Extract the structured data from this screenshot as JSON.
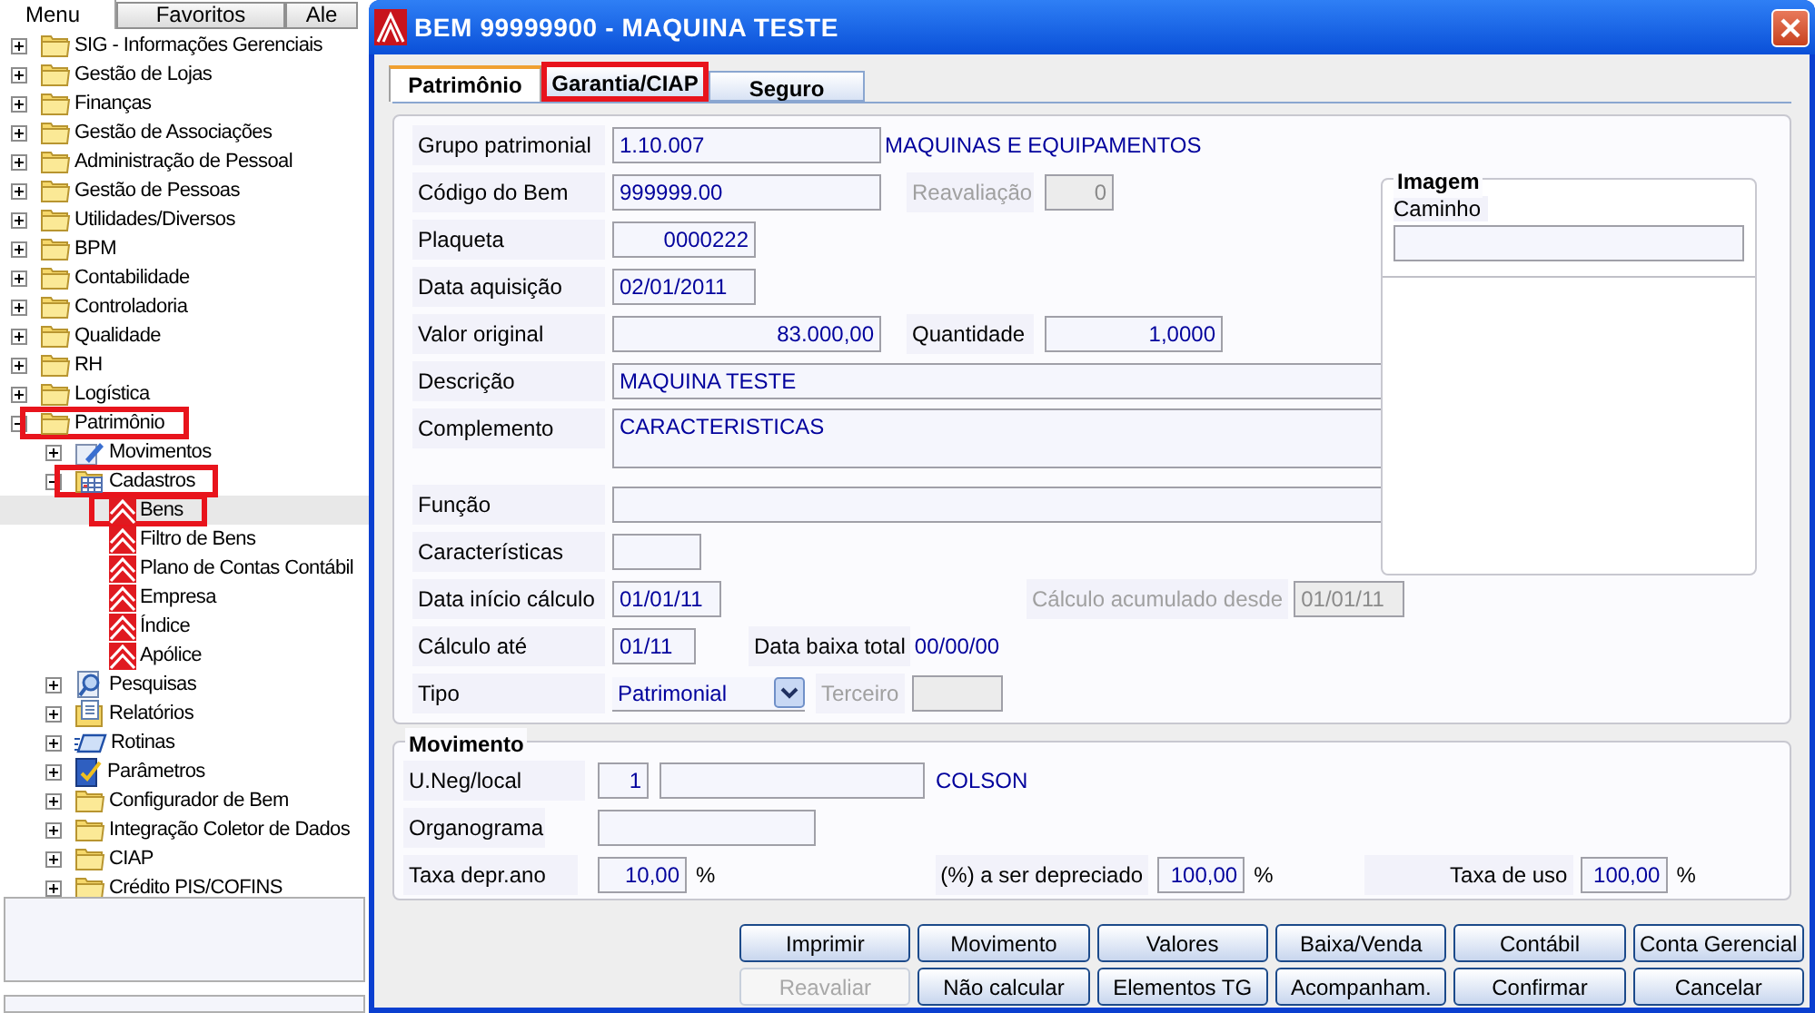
{
  "sidebar": {
    "tabs": [
      {
        "label": "Menu",
        "selected": true
      },
      {
        "label": "Favoritos",
        "selected": false
      },
      {
        "label": "Ale",
        "selected": false
      }
    ],
    "tree": [
      {
        "label": "SIG - Informações Gerenciais",
        "kind": "folder",
        "expanded": false,
        "selected": false
      },
      {
        "label": "Gestão de Lojas",
        "kind": "folder",
        "expanded": false,
        "selected": false
      },
      {
        "label": "Finanças",
        "kind": "folder",
        "expanded": false,
        "selected": false
      },
      {
        "label": "Gestão de Associações",
        "kind": "folder",
        "expanded": false,
        "selected": false
      },
      {
        "label": "Administração de Pessoal",
        "kind": "folder",
        "expanded": false,
        "selected": false
      },
      {
        "label": "Gestão de Pessoas",
        "kind": "folder",
        "expanded": false,
        "selected": false
      },
      {
        "label": "Utilidades/Diversos",
        "kind": "folder",
        "expanded": false,
        "selected": false
      },
      {
        "label": "BPM",
        "kind": "folder",
        "expanded": false,
        "selected": false
      },
      {
        "label": "Contabilidade",
        "kind": "folder",
        "expanded": false,
        "selected": false
      },
      {
        "label": "Controladoria",
        "kind": "folder",
        "expanded": false,
        "selected": false
      },
      {
        "label": "Qualidade",
        "kind": "folder",
        "expanded": false,
        "selected": false
      },
      {
        "label": "RH",
        "kind": "folder",
        "expanded": false,
        "selected": false
      },
      {
        "label": "Logística",
        "kind": "folder",
        "expanded": false,
        "selected": false
      },
      {
        "label": "Patrimônio",
        "kind": "folder",
        "expanded": true,
        "selected": false,
        "highlighted": true,
        "children": [
          {
            "label": "Movimentos",
            "kind": "pencil",
            "expanded": false,
            "selected": false
          },
          {
            "label": "Cadastros",
            "kind": "grid",
            "expanded": true,
            "selected": false,
            "highlighted": true,
            "children": [
              {
                "label": "Bens",
                "kind": "red",
                "selected": true,
                "highlighted": true
              },
              {
                "label": "Filtro de Bens",
                "kind": "red",
                "selected": false
              },
              {
                "label": "Plano de Contas Contábil",
                "kind": "red",
                "selected": false
              },
              {
                "label": "Empresa",
                "kind": "red",
                "selected": false
              },
              {
                "label": "Índice",
                "kind": "red",
                "selected": false
              },
              {
                "label": "Apólice",
                "kind": "red",
                "selected": false
              }
            ]
          },
          {
            "label": "Pesquisas",
            "kind": "magnifier",
            "expanded": false,
            "selected": false
          },
          {
            "label": "Relatórios",
            "kind": "document",
            "expanded": false,
            "selected": false
          },
          {
            "label": "Rotinas",
            "kind": "routine",
            "expanded": false,
            "selected": false
          },
          {
            "label": "Parâmetros",
            "kind": "parameter",
            "expanded": false,
            "selected": false
          },
          {
            "label": "Configurador de Bem",
            "kind": "folder",
            "expanded": false,
            "selected": false
          },
          {
            "label": "Integração Coletor de Dados",
            "kind": "folder",
            "expanded": false,
            "selected": false
          },
          {
            "label": "CIAP",
            "kind": "folder",
            "expanded": false,
            "selected": false
          },
          {
            "label": "Crédito PIS/COFINS",
            "kind": "folder",
            "expanded": false,
            "selected": false
          }
        ]
      }
    ]
  },
  "dialog": {
    "title": "BEM 99999900 - MAQUINA TESTE",
    "tabs": [
      {
        "label": "Patrimônio",
        "selected": true,
        "highlighted": false
      },
      {
        "label": "Garantia/CIAP",
        "selected": false,
        "highlighted": true
      },
      {
        "label": "Seguro",
        "selected": false,
        "highlighted": false
      }
    ],
    "form": {
      "grupo_patrimonial": {
        "label": "Grupo patrimonial",
        "value": "1.10.007",
        "description": "MAQUINAS E EQUIPAMENTOS"
      },
      "codigo_do_bem": {
        "label": "Código do Bem",
        "value": "999999.00"
      },
      "reavaliacao": {
        "label": "Reavaliação",
        "value": "0",
        "disabled": true
      },
      "plaqueta": {
        "label": "Plaqueta",
        "value": "0000222"
      },
      "data_aquisicao": {
        "label": "Data aquisição",
        "value": "02/01/2011"
      },
      "valor_original": {
        "label": "Valor original",
        "value": "83.000,00"
      },
      "quantidade": {
        "label": "Quantidade",
        "value": "1,0000"
      },
      "descricao": {
        "label": "Descrição",
        "value": "MAQUINA TESTE"
      },
      "complemento": {
        "label": "Complemento",
        "value": "CARACTERISTICAS"
      },
      "funcao": {
        "label": "Função"
      },
      "caracteristicas": {
        "label": "Características"
      },
      "data_inicio_calculo": {
        "label": "Data início cálculo",
        "value": "01/01/11"
      },
      "calculo_acumulado_desde": {
        "label": "Cálculo acumulado desde",
        "value": "01/01/11",
        "disabled": true
      },
      "calculo_ate": {
        "label": "Cálculo até",
        "value": "01/11"
      },
      "data_baixa_total": {
        "label": "Data baixa total",
        "value": "00/00/00"
      },
      "tipo": {
        "label": "Tipo",
        "value": "Patrimonial"
      },
      "terceiro": {
        "label": "Terceiro",
        "disabled": true
      }
    },
    "imagem": {
      "title": "Imagem",
      "caminho_label": "Caminho"
    },
    "movimento": {
      "title": "Movimento",
      "u_neg_local": {
        "label": "U.Neg/local",
        "value": "1",
        "description": "COLSON"
      },
      "organograma": {
        "label": "Organograma"
      },
      "taxa_depr_ano": {
        "label": "Taxa depr.ano",
        "value": "10,00",
        "unit": "%"
      },
      "a_ser_depreciado": {
        "label": "(%) a ser depreciado",
        "value": "100,00",
        "unit": "%"
      },
      "taxa_de_uso": {
        "label": "Taxa de uso",
        "value": "100,00",
        "unit": "%"
      }
    },
    "buttons": [
      {
        "label": "Imprimir",
        "disabled": false
      },
      {
        "label": "Movimento",
        "disabled": false
      },
      {
        "label": "Valores",
        "disabled": false
      },
      {
        "label": "Baixa/Venda",
        "disabled": false
      },
      {
        "label": "Contábil",
        "disabled": false
      },
      {
        "label": "Conta Gerencial",
        "disabled": false
      },
      {
        "label": "Reavaliar",
        "disabled": true
      },
      {
        "label": "Não calcular",
        "disabled": false
      },
      {
        "label": "Elementos TG",
        "disabled": false
      },
      {
        "label": "Acompanham.",
        "disabled": false
      },
      {
        "label": "Confirmar",
        "disabled": false
      },
      {
        "label": "Cancelar",
        "disabled": false
      }
    ]
  }
}
